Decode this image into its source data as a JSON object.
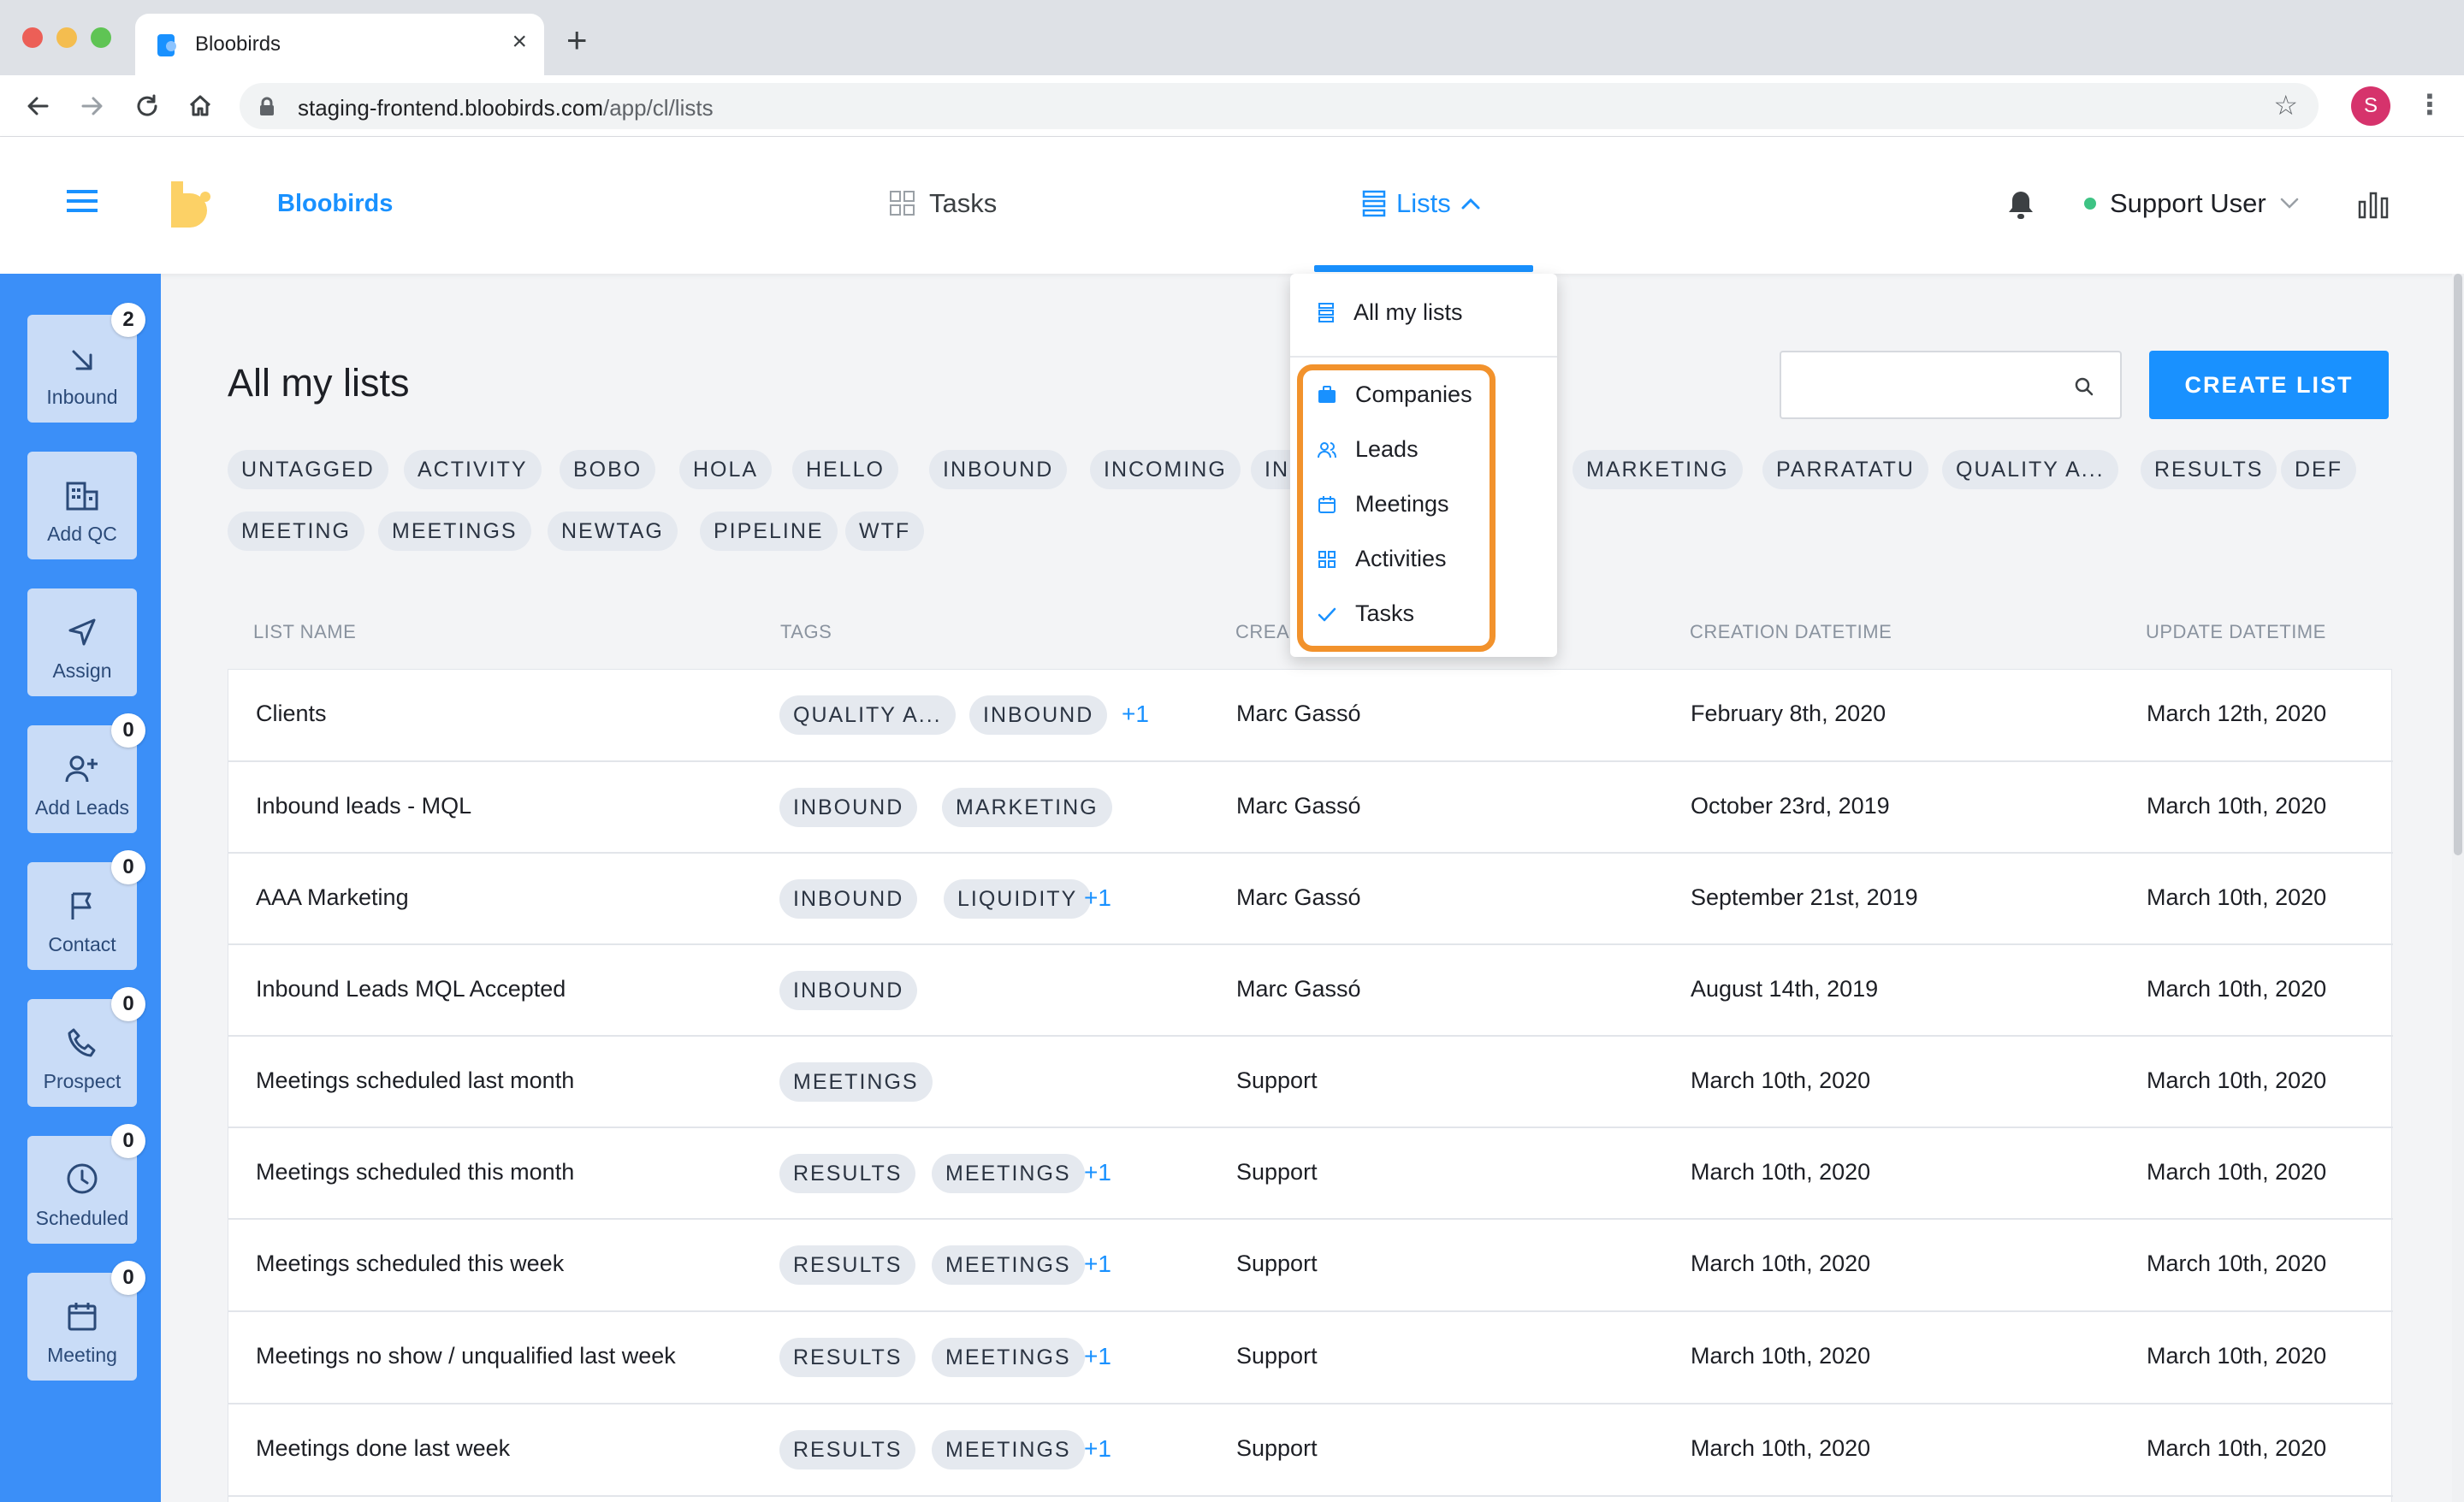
{
  "browser": {
    "tab_title": "Bloobirds",
    "url_host": "staging-frontend.bloobirds.com",
    "url_path": "/app/cl/lists",
    "profile_initial": "S"
  },
  "header": {
    "brand": "Bloobirds",
    "nav_tasks": "Tasks",
    "nav_lists": "Lists",
    "user_name": "Support User"
  },
  "sidebar": [
    {
      "label": "Inbound",
      "badge": "2",
      "icon": "arrow-down-right-icon"
    },
    {
      "label": "Add QC",
      "badge": null,
      "icon": "building-icon"
    },
    {
      "label": "Assign",
      "badge": null,
      "icon": "send-icon"
    },
    {
      "label": "Add Leads",
      "badge": "0",
      "icon": "user-plus-icon"
    },
    {
      "label": "Contact",
      "badge": "0",
      "icon": "flag-icon"
    },
    {
      "label": "Prospect",
      "badge": "0",
      "icon": "phone-icon"
    },
    {
      "label": "Scheduled",
      "badge": "0",
      "icon": "clock-icon"
    },
    {
      "label": "Meeting",
      "badge": "0",
      "icon": "calendar-icon"
    }
  ],
  "main": {
    "title": "All my lists",
    "search_placeholder": "",
    "create_button": "CREATE LIST",
    "tag_filters": [
      "UNTAGGED",
      "ACTIVITY",
      "BOBO",
      "HOLA",
      "HELLO",
      "INBOUND",
      "INCOMING",
      "INS",
      "MARKETING",
      "PARRATATU",
      "QUALITY A...",
      "RESULTS",
      "DEF",
      "MEETING",
      "MEETINGS",
      "NEWTAG",
      "PIPELINE",
      "WTF"
    ],
    "columns": [
      "LIST NAME",
      "TAGS",
      "CREA",
      "CREATION DATETIME",
      "UPDATE DATETIME"
    ],
    "rows": [
      {
        "name": "Clients",
        "tags": [
          "QUALITY A...",
          "INBOUND"
        ],
        "extra": "+1",
        "creator": "Marc Gassó",
        "created": "February 8th, 2020",
        "updated": "March 12th, 2020"
      },
      {
        "name": "Inbound leads - MQL",
        "tags": [
          "INBOUND",
          "MARKETING"
        ],
        "extra": "",
        "creator": "Marc Gassó",
        "created": "October 23rd, 2019",
        "updated": "March 10th, 2020"
      },
      {
        "name": "AAA Marketing",
        "tags": [
          "INBOUND",
          "LIQUIDITY"
        ],
        "extra": "+1",
        "creator": "Marc Gassó",
        "created": "September 21st, 2019",
        "updated": "March 10th, 2020"
      },
      {
        "name": "Inbound Leads MQL Accepted",
        "tags": [
          "INBOUND"
        ],
        "extra": "",
        "creator": "Marc Gassó",
        "created": "August 14th, 2019",
        "updated": "March 10th, 2020"
      },
      {
        "name": "Meetings scheduled last month",
        "tags": [
          "MEETINGS"
        ],
        "extra": "",
        "creator": "Support",
        "created": "March 10th, 2020",
        "updated": "March 10th, 2020"
      },
      {
        "name": "Meetings scheduled this month",
        "tags": [
          "RESULTS",
          "MEETINGS"
        ],
        "extra": "+1",
        "creator": "Support",
        "created": "March 10th, 2020",
        "updated": "March 10th, 2020"
      },
      {
        "name": "Meetings scheduled this week",
        "tags": [
          "RESULTS",
          "MEETINGS"
        ],
        "extra": "+1",
        "creator": "Support",
        "created": "March 10th, 2020",
        "updated": "March 10th, 2020"
      },
      {
        "name": "Meetings no show / unqualified last week",
        "tags": [
          "RESULTS",
          "MEETINGS"
        ],
        "extra": "+1",
        "creator": "Support",
        "created": "March 10th, 2020",
        "updated": "March 10th, 2020"
      },
      {
        "name": "Meetings done last week",
        "tags": [
          "RESULTS",
          "MEETINGS"
        ],
        "extra": "+1",
        "creator": "Support",
        "created": "March 10th, 2020",
        "updated": "March 10th, 2020"
      }
    ]
  },
  "dropdown": {
    "all": "All my lists",
    "items": [
      {
        "label": "Companies",
        "icon": "briefcase-icon"
      },
      {
        "label": "Leads",
        "icon": "users-icon"
      },
      {
        "label": "Meetings",
        "icon": "calendar-icon"
      },
      {
        "label": "Activities",
        "icon": "grid-icon"
      },
      {
        "label": "Tasks",
        "icon": "check-icon"
      }
    ]
  },
  "colors": {
    "accent": "#1991ff",
    "sidebar": "#3b8ff8",
    "highlight": "#f2922c"
  }
}
